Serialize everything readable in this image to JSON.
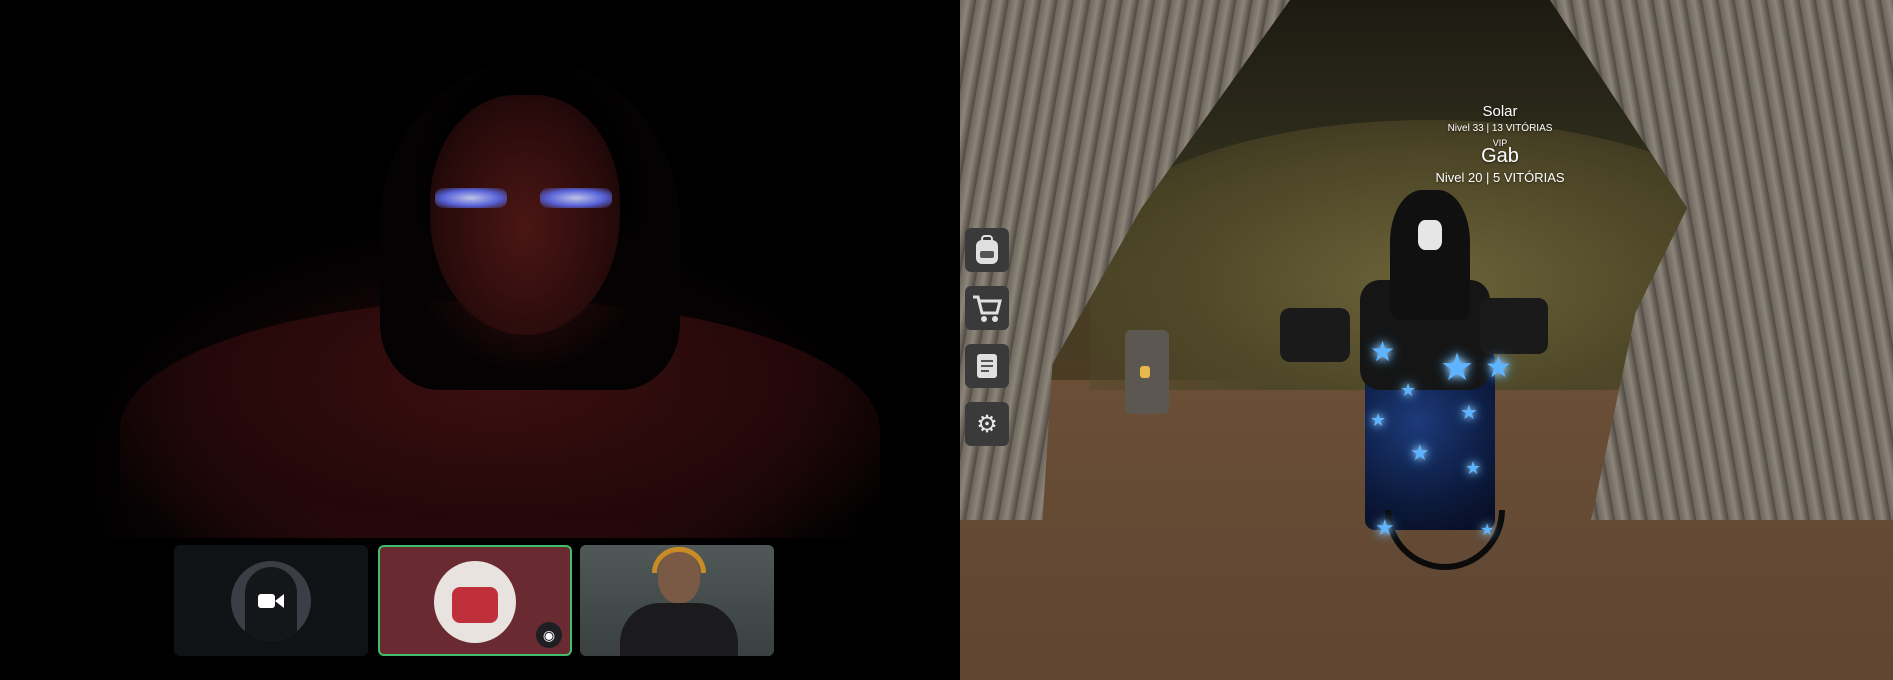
{
  "call": {
    "participants": [
      {
        "id": "camera-off-user",
        "icon": "video-camera-icon",
        "speaking": false
      },
      {
        "id": "bot-user",
        "icon": "speaker-badge-icon",
        "speaking": true
      },
      {
        "id": "headphones-user",
        "icon": "none",
        "speaking": false
      }
    ],
    "speaking_border_color": "#3fbf6a"
  },
  "game": {
    "players": [
      {
        "name": "Solar",
        "stats": "Nivel 33 | 13 VITÓRIAS"
      },
      {
        "tag": "VIP",
        "name": "Gab",
        "stats": "Nivel 20 | 5 VITÓRIAS"
      }
    ],
    "side_menu": [
      {
        "name": "backpack",
        "icon": "backpack-icon"
      },
      {
        "name": "shop",
        "icon": "cart-icon"
      },
      {
        "name": "quests",
        "icon": "scroll-icon"
      },
      {
        "name": "settings",
        "icon": "gears-icon"
      }
    ]
  }
}
